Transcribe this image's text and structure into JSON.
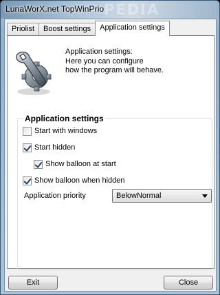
{
  "window": {
    "title": "LunaWorX.net TopWinPrio",
    "title_bg_text": "PEDIA"
  },
  "tabs": [
    {
      "label": "Priolist",
      "active": false
    },
    {
      "label": "Boost settings",
      "active": false
    },
    {
      "label": "Application settings",
      "active": true
    }
  ],
  "intro": {
    "line1": "Application settings:",
    "line2": "Here you can configure",
    "line3": "how the program will behave."
  },
  "settings": {
    "group_title": "Application settings",
    "start_with_windows": {
      "label": "Start with windows",
      "checked": false
    },
    "start_hidden": {
      "label": "Start hidden",
      "checked": true
    },
    "show_balloon_at_start": {
      "label": "Show balloon at start",
      "checked": true
    },
    "show_balloon_when_hidden": {
      "label": "Show balloon when hidden",
      "checked": true
    },
    "priority_label": "Application priority",
    "priority_value": "BelowNormal"
  },
  "buttons": {
    "exit": "Exit",
    "close": "Close"
  },
  "colors": {
    "check_mark": "#1c3f7a",
    "titlebar": "#9cb6cc"
  },
  "icons": {
    "logo": "wrench-gear-icon"
  }
}
